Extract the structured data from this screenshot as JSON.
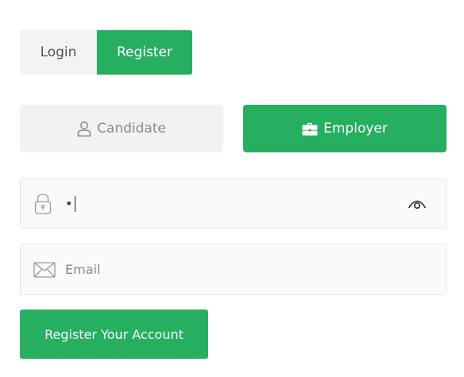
{
  "tabs": {
    "login_label": "Login",
    "register_label": "Register"
  },
  "roles": {
    "candidate_label": "Candidate",
    "candidate_icon": "user-icon",
    "employer_label": "Employer",
    "employer_icon": "briefcase-icon"
  },
  "password_field": {
    "value": "•",
    "icon": "padlock-icon",
    "toggle_icon": "eye-icon"
  },
  "email_field": {
    "placeholder": "Email",
    "value": "",
    "icon": "envelope-icon"
  },
  "submit": {
    "label": "Register Your Account"
  },
  "colors": {
    "accent": "#26ae61",
    "inactive_bg": "#f2f2f2",
    "inactive_text": "#8a8a8a",
    "field_bg": "#fafafa",
    "field_border": "#e3e3e3"
  }
}
